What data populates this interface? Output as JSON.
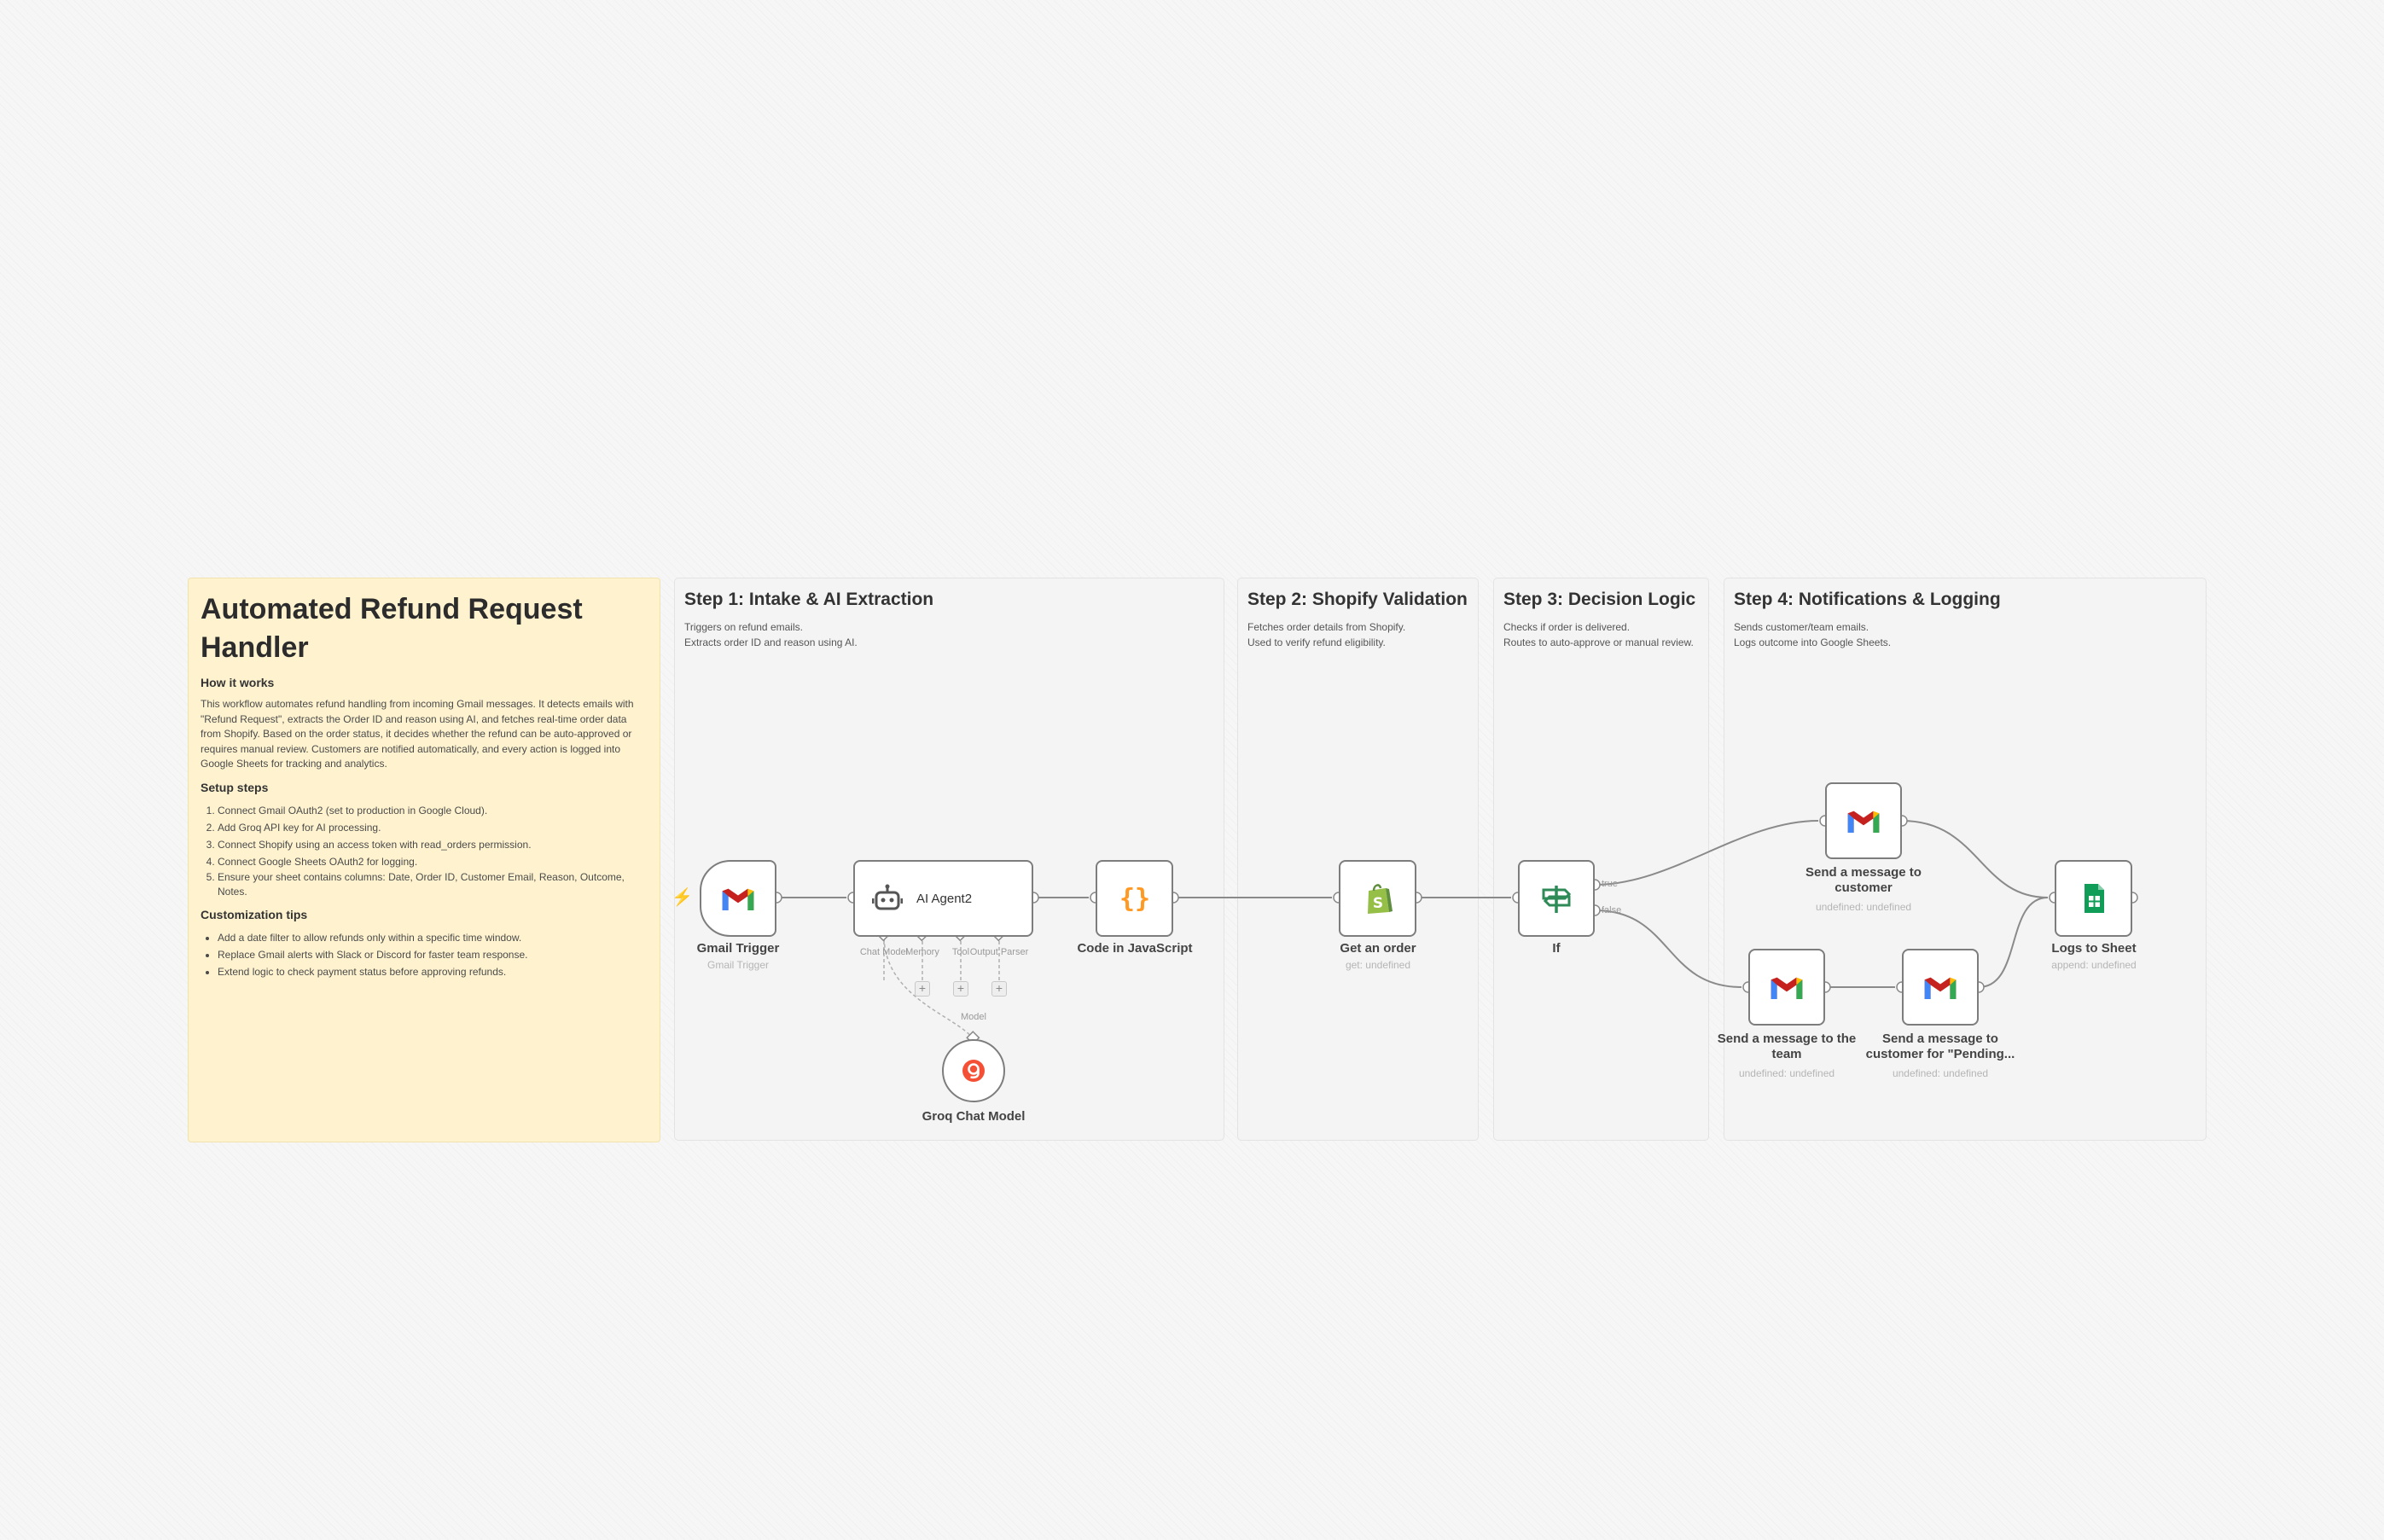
{
  "sticky": {
    "title": "Automated Refund Request Handler",
    "how_heading": "How it works",
    "how_text": "This workflow automates refund handling from incoming Gmail messages. It detects emails with \"Refund Request\", extracts the Order ID and reason using AI, and fetches real-time order data from Shopify. Based on the order status, it decides whether the refund can be auto-approved or requires manual review. Customers are notified automatically, and every action is logged into Google Sheets for tracking and analytics.",
    "setup_heading": "Setup steps",
    "setup_steps": [
      "Connect Gmail OAuth2 (set to production in Google Cloud).",
      "Add Groq API key for AI processing.",
      "Connect Shopify using an access token with read_orders permission.",
      "Connect Google Sheets OAuth2 for logging.",
      "Ensure your sheet contains columns: Date, Order ID, Customer Email, Reason, Outcome, Notes."
    ],
    "custom_heading": "Customization tips",
    "custom_tips": [
      "Add a date filter to allow refunds only within a specific time window.",
      "Replace Gmail alerts with Slack or Discord for faster team response.",
      "Extend logic to check payment status before approving refunds."
    ]
  },
  "sections": [
    {
      "title": "Step 1: Intake & AI Extraction",
      "desc": "Triggers on refund emails.\nExtracts order ID and reason using AI."
    },
    {
      "title": "Step 2: Shopify Validation",
      "desc": "Fetches order details from Shopify.\nUsed to verify refund eligibility."
    },
    {
      "title": "Step 3: Decision Logic",
      "desc": "Checks if order is delivered.\nRoutes to auto-approve or manual review."
    },
    {
      "title": "Step 4: Notifications & Logging",
      "desc": "Sends customer/team emails.\nLogs outcome into Google Sheets."
    }
  ],
  "nodes": {
    "gmail_trigger": {
      "label": "Gmail Trigger",
      "sub": "Gmail Trigger",
      "icon": "gmail-icon"
    },
    "ai_agent": {
      "label": "AI Agent2",
      "icon": "robot-icon"
    },
    "code": {
      "label": "Code in JavaScript",
      "icon": "code-braces-icon"
    },
    "groq": {
      "label": "Groq Chat Model",
      "icon": "groq-icon"
    },
    "shopify": {
      "label": "Get an order",
      "sub": "get: undefined",
      "icon": "shopify-icon"
    },
    "if": {
      "label": "If",
      "icon": "signpost-icon"
    },
    "send_customer": {
      "label_line1": "Send a message to",
      "label_line2": "customer",
      "sub": "undefined: undefined",
      "icon": "gmail-icon"
    },
    "send_team": {
      "label_line1": "Send a message to the",
      "label_line2": "team",
      "sub": "undefined: undefined",
      "icon": "gmail-icon"
    },
    "send_pending": {
      "label_line1": "Send a message to",
      "label_line2": "customer for \"Pending...",
      "sub": "undefined: undefined",
      "icon": "gmail-icon"
    },
    "sheets": {
      "label": "Logs to Sheet",
      "sub": "append: undefined",
      "icon": "google-sheets-icon"
    }
  },
  "agent_ports": {
    "chat_model": "Chat Model",
    "memory": "Memory",
    "tool": "Tool",
    "output_parser": "Output Parser",
    "model": "Model"
  },
  "branches": {
    "true_label": "true",
    "false_label": "false"
  },
  "colors": {
    "canvas": "#f6f6f6",
    "sticky": "#fff3cf",
    "section": "#f4f4f4",
    "node_border": "#7d7d7d",
    "edge": "#8a8a8a",
    "trigger_bolt": "#ff6d5a"
  }
}
